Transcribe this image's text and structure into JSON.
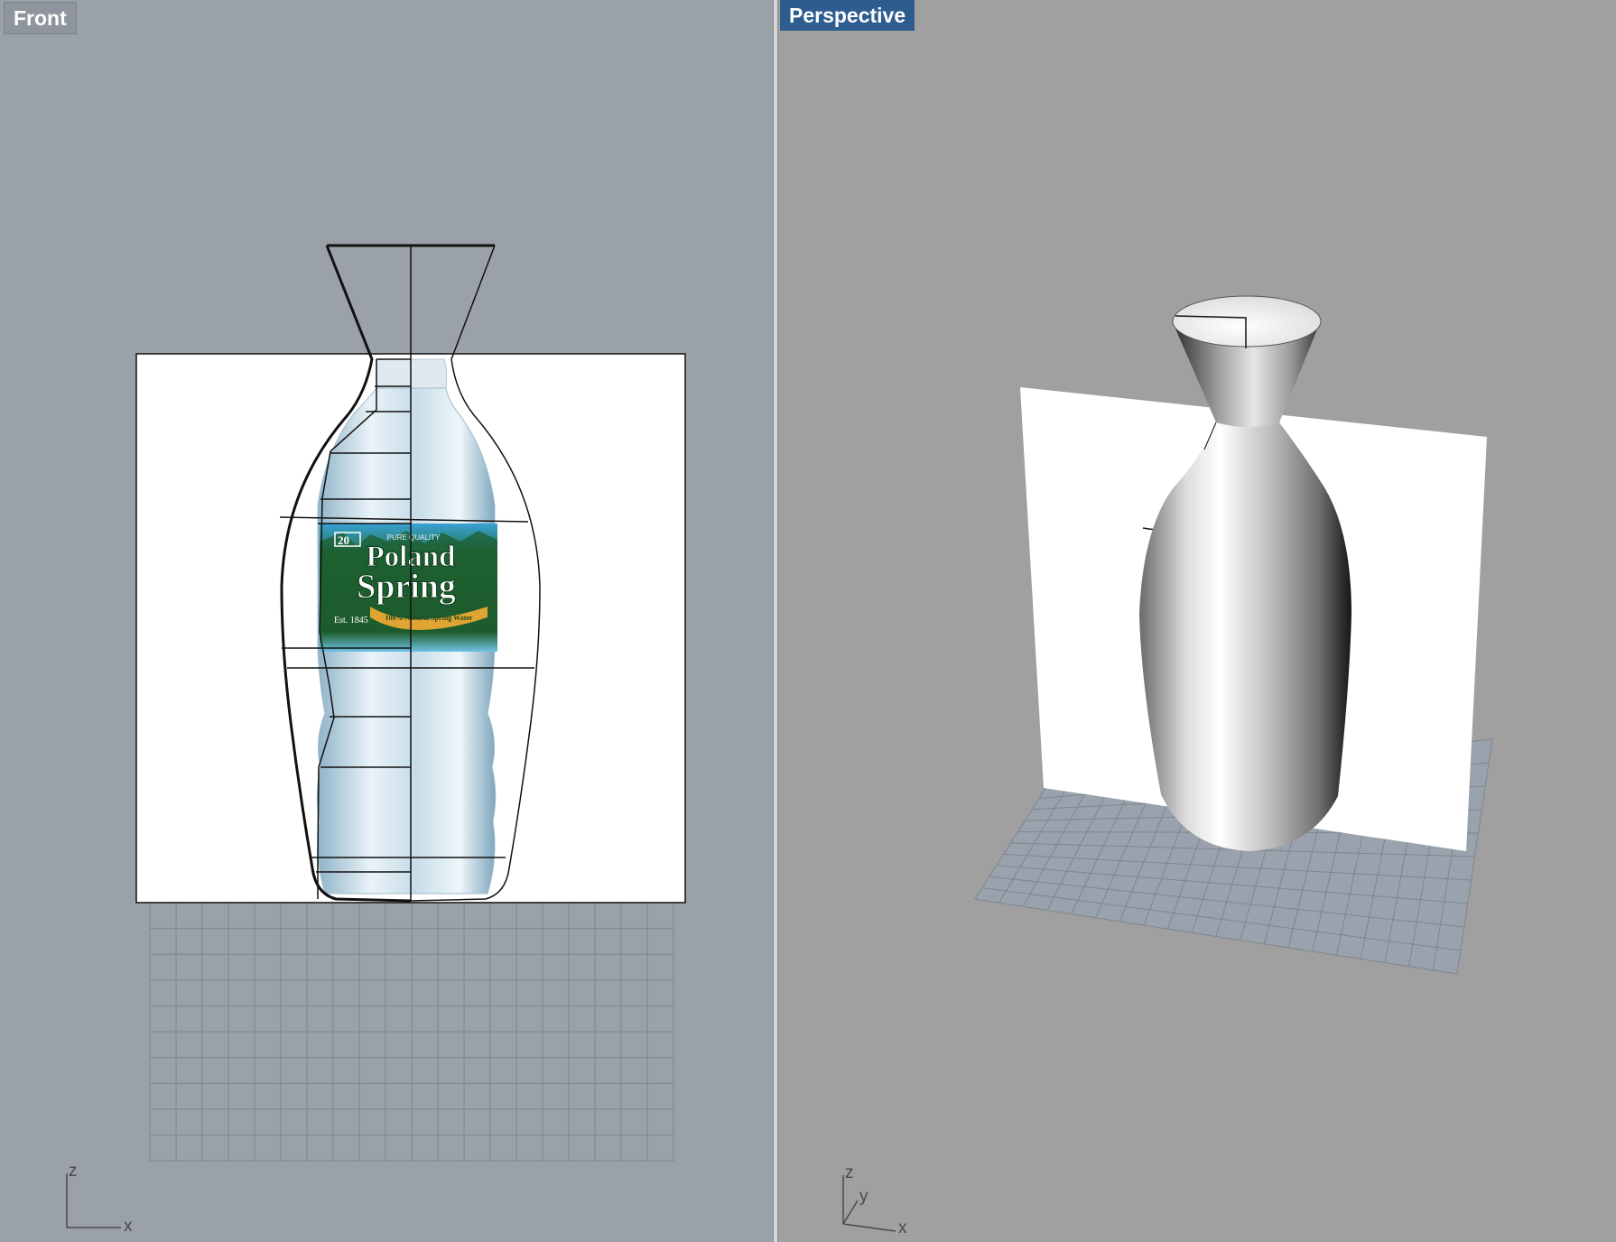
{
  "viewports": {
    "front": {
      "title": "Front",
      "axes": {
        "vertical": "z",
        "horizontal": "x"
      },
      "colors": {
        "background": "#9ba1a8",
        "grid": "#7f858d",
        "outline": "#111111"
      }
    },
    "perspective": {
      "title": "Perspective",
      "active": true,
      "axes": {
        "vertical": "z",
        "depth": "y",
        "horizontal": "x"
      },
      "colors": {
        "background": "#a0a0a0",
        "tab": "#2d5d8f",
        "grid": "#7f858d"
      }
    }
  },
  "reference_image": {
    "brand_line1": "Poland",
    "brand_line2": "Spring",
    "tagline": "PURE QUALITY",
    "size_badge": "20",
    "established": "Est. 1845",
    "ribbon": "100% Natural Spring Water"
  }
}
